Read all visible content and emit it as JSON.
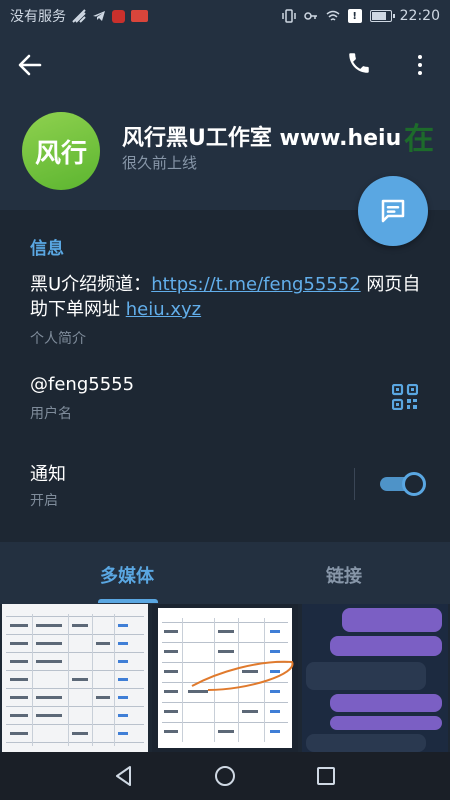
{
  "status_bar": {
    "carrier": "没有服务",
    "time": "22:20"
  },
  "header": {
    "avatar_text": "风行",
    "title": "风行黑U工作室 www.heiu",
    "title_extra": "在",
    "subtitle": "很久前上线"
  },
  "info": {
    "section_title": "信息",
    "bio_prefix": "黑U介绍频道：",
    "bio_link": "https://t.me/feng55552",
    "bio_middle": " 网页自助下单网址 ",
    "bio_link2": "heiu.xyz",
    "bio_label": "个人简介",
    "username": "@feng5555",
    "username_label": "用户名",
    "notify_title": "通知",
    "notify_value": "开启"
  },
  "tabs": {
    "media": "多媒体",
    "links": "链接"
  },
  "colors": {
    "accent": "#5aa7e2",
    "background": "#1d2733",
    "header": "#233040",
    "avatar": "#6fc23a"
  },
  "icons": [
    "back-arrow-icon",
    "phone-icon",
    "more-vert-icon",
    "message-icon",
    "qr-code-icon",
    "nav-back-icon",
    "nav-home-icon",
    "nav-recents-icon"
  ]
}
